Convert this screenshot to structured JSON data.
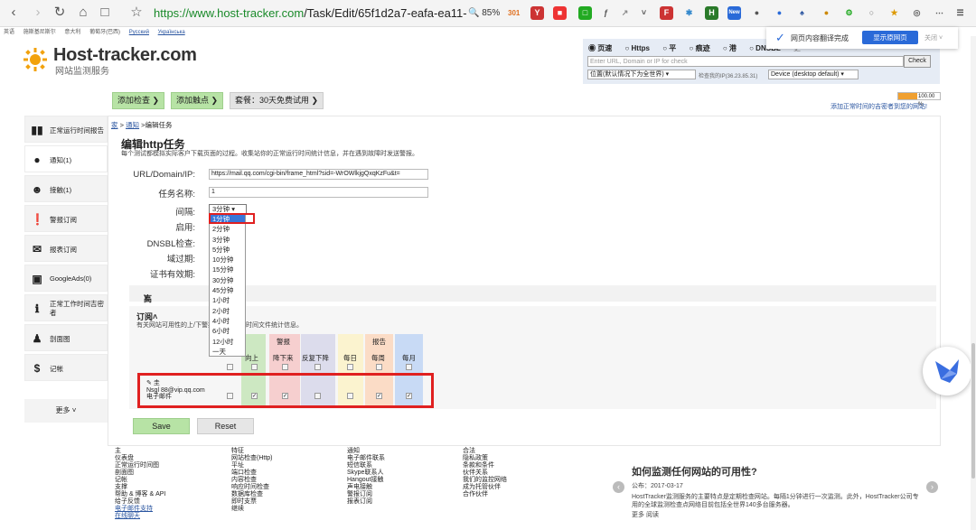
{
  "browser": {
    "url_prefix": "https://",
    "url_domain": "www.host-tracker.com",
    "url_rest": "/Task/Edit/65f1d2a7-eafa-ea11-",
    "zoom": "85%",
    "badge": "301"
  },
  "langbar": [
    "英语",
    "施斯基尼斯尔",
    "意大利",
    "葡萄牙(巴西)",
    "Русский",
    "Українська"
  ],
  "logo": {
    "title": "Host-tracker.com",
    "subtitle": "网站监测服务"
  },
  "checkpanel": {
    "radios": [
      "页速",
      "Https",
      "平",
      "痕迹",
      "港",
      "DNSBL",
      "更"
    ],
    "placeholder": "Enter URL, Domain or IP for check",
    "check_label": "Check",
    "location": "位置(默认情况下为全世界)",
    "ip_text": "检查我的IP(36.23.85.31)",
    "device": "Device (desktop default)"
  },
  "translate": {
    "message": "网页内容翻译完成",
    "button": "显示原网页",
    "close": "关闭"
  },
  "toolbar": {
    "add_check": "添加检查",
    "add_contact": "添加触点",
    "plan": "套餐：30天免费试用"
  },
  "uptime": {
    "value": "100.00 %",
    "fill_fraction": 0.45,
    "link": "添加正常时间的吉密者到您的网站!"
  },
  "sidebar": {
    "items": [
      {
        "label": "正常运行时间报告",
        "icon": "bar-chart-icon"
      },
      {
        "label": "通知(1)",
        "icon": "globe-icon"
      },
      {
        "label": "接触(1)",
        "icon": "users-icon"
      },
      {
        "label": "警报订阅",
        "icon": "alert-icon"
      },
      {
        "label": "报表订阅",
        "icon": "mail-icon"
      },
      {
        "label": "GoogleAds(0)",
        "icon": "sitemap-icon"
      },
      {
        "label": "正常工作时间吉密者",
        "icon": "info-icon"
      },
      {
        "label": "剖面图",
        "icon": "user-icon"
      },
      {
        "label": "记帐",
        "icon": "dollar-icon"
      }
    ],
    "more": "更多"
  },
  "breadcrumb": {
    "home": "家",
    "tasks": "通知",
    "current": "编辑任务"
  },
  "form": {
    "title": "编辑http任务",
    "desc": "每个测试都模拟实际客户下载页面的过程。收集站你的正常运行时间统计信息，并在遇到故障时发送警报。",
    "labels": {
      "url": "URL/Domain/IP:",
      "name": "任务名称:",
      "interval": "间隔:",
      "enabled": "启用:",
      "dnsbl": "DNSBL检查:",
      "domain": "域过期:",
      "cert": "证书有效期:"
    },
    "url_value": "https://mail.qq.com/cgi-bin/frame_html?sid=-WrOWlkjgQxqKzFu&t=",
    "name_value": "1",
    "interval_value": "3分钟",
    "interval_options": [
      "1分钟",
      "2分钟",
      "3分钟",
      "5分钟",
      "10分钟",
      "15分钟",
      "30分钟",
      "45分钟",
      "1小时",
      "2小时",
      "4小时",
      "6小时",
      "12小时",
      "一天"
    ],
    "advanced": "高级选项",
    "subs_title": "订阅",
    "subs_desc": "有关网站可用性的上/下警报和正常运行时间文件统计信息。",
    "alerts_group": "警报",
    "reports_group": "报告",
    "col_up": "向上",
    "col_down": "降下来",
    "col_repeat": "反复下降",
    "col_daily": "每日",
    "col_weekly": "每周",
    "col_monthly": "每月",
    "user_name": "圭",
    "user_email": "Nsgl 88@vip.qq.com",
    "user_type": "电子邮件",
    "save": "Save",
    "reset": "Reset"
  },
  "colors": {
    "up": "#cde8c2",
    "down": "#f6cfcf",
    "repeat": "#dcdcec",
    "daily": "#fbf3cf",
    "weekly": "#fbdcc6",
    "monthly": "#c8daf5"
  },
  "footer": {
    "col1": [
      "主",
      "仪表盘",
      "正常运行时间图",
      "剖面图",
      "记帐",
      "支撑",
      "帮助 & 博客 & API",
      "给子反馈",
      "电子邮件支持",
      "在线聊天"
    ],
    "col2": [
      "特征",
      "网站检查(Http)",
      "平址",
      "端口检查",
      "内容检查",
      "响应时间检查",
      "数据库检查",
      "即时支票",
      "继续"
    ],
    "col3": [
      "通知",
      "电子邮件联系",
      "短信联系",
      "Skype联系人",
      "Hangout接触",
      "声电接触",
      "警报订阅",
      "报表订阅"
    ],
    "col4": [
      "合法",
      "隐私政策",
      "条款和条件",
      "伙伴关系",
      "我们的监控网络",
      "成为托管伙伴",
      "合作伙伴"
    ]
  },
  "news": {
    "title": "如何监测任何网站的可用性?",
    "date": "公布：2017-03-17",
    "text": "HostTracker监测服务的主要特点是定期检查网站。每隔1分钟进行一次监测。此外，HostTracker公司专用的全球监测检查点网络目前包括全世界140多台服务器。",
    "more": "更多",
    "more2": "阅读"
  }
}
